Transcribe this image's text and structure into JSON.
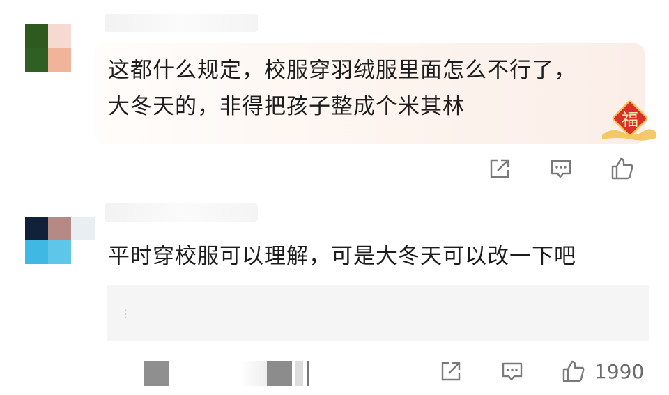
{
  "comments": [
    {
      "text_line1": "这都什么规定，校服穿羽绒服里面怎么不行了，",
      "text_line2": "大冬天的，非得把孩子整成个米其林",
      "badge_char": "福",
      "avatar_colors": [
        "#2e5a1f",
        "#f6d9d1",
        "#2f5f22",
        "#f0b49a"
      ]
    },
    {
      "text_line1": "平时穿校服可以理解，可是大冬天可以改一下吧",
      "avatar_colors": [
        "#12213a",
        "#b58a84",
        "#3fb9e4",
        "#5ec6e8"
      ],
      "like_count": "1990"
    }
  ],
  "icons": {
    "share": "share-icon",
    "reply": "comment-icon",
    "like": "thumbs-up-icon"
  },
  "colors": {
    "text": "#1c1c1c",
    "icon": "#7a7a7a",
    "badge_red": "#d9302c",
    "badge_gold": "#f2c14e"
  }
}
